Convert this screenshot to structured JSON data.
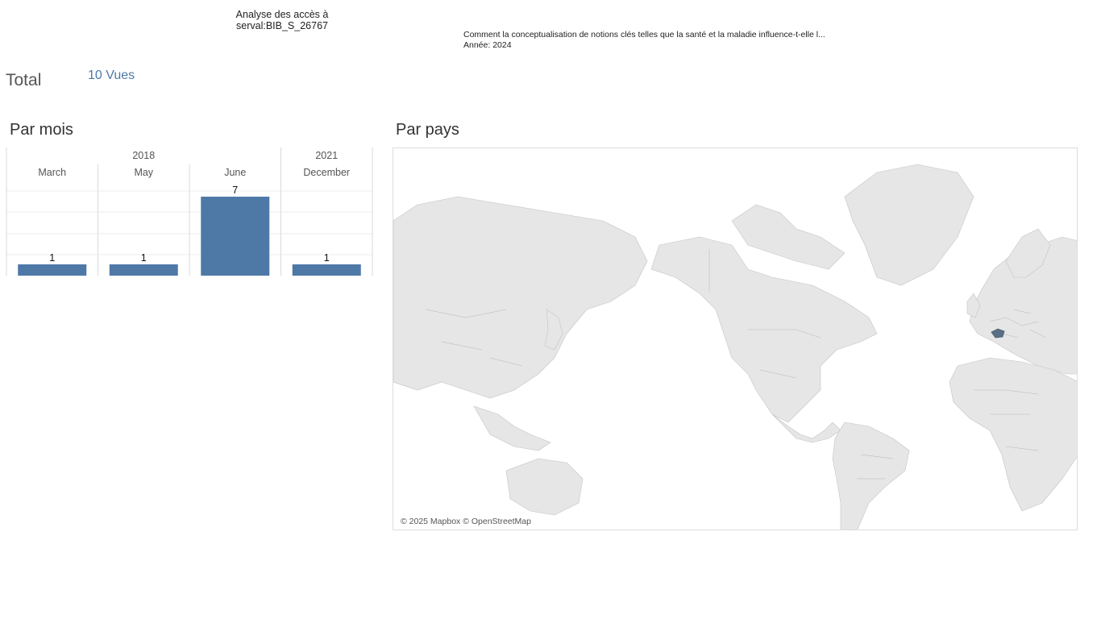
{
  "header": {
    "title_line1": "Analyse des accès à",
    "title_line2": "serval:BIB_S_26767",
    "doc_title": "Comment la conceptualisation de notions clés telles que la santé et la maladie influence-t-elle l...",
    "doc_year": "Année: 2024"
  },
  "total": {
    "label": "Total",
    "value": "10 Vues"
  },
  "sections": {
    "by_month": "Par mois",
    "by_country": "Par pays"
  },
  "colors": {
    "bar": "#4e79a7",
    "land": "#e6e6e6",
    "highlight": "#5a6f86",
    "border": "#a9a9a9"
  },
  "chart_data": {
    "type": "bar",
    "years": [
      {
        "label": "2018",
        "span": 3
      },
      {
        "label": "2021",
        "span": 1
      }
    ],
    "categories": [
      "March",
      "May",
      "June",
      "December"
    ],
    "values": [
      1,
      1,
      7,
      1
    ],
    "ylim": [
      0,
      7.5
    ],
    "grid": true,
    "title": "",
    "xlabel": "",
    "ylabel": ""
  },
  "map": {
    "highlighted_country": "Switzerland",
    "attribution": "© 2025 Mapbox © OpenStreetMap"
  }
}
